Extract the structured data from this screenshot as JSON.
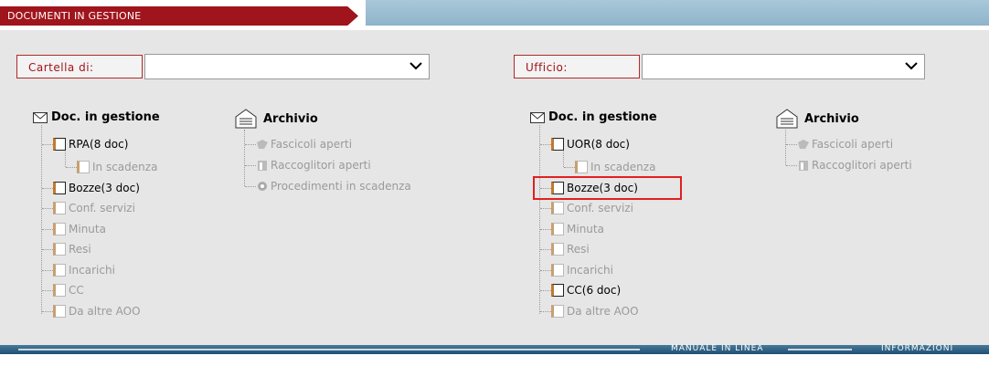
{
  "header": {
    "title": "DOCUMENTI IN GESTIONE"
  },
  "left": {
    "filter_label": "Cartella di:",
    "select_value": "",
    "doc_root": "Doc. in gestione",
    "archive_root": "Archivio",
    "doc_items": [
      {
        "label": "RPA(8 doc)",
        "active": true
      },
      {
        "label": "In scadenza",
        "active": false
      },
      {
        "label": "Bozze(3 doc)",
        "active": true
      },
      {
        "label": "Conf. servizi",
        "active": false
      },
      {
        "label": "Minuta",
        "active": false
      },
      {
        "label": "Resi",
        "active": false
      },
      {
        "label": "Incarichi",
        "active": false
      },
      {
        "label": "CC",
        "active": false
      },
      {
        "label": "Da altre AOO",
        "active": false
      }
    ],
    "archive_items": [
      {
        "label": "Fascicoli aperti",
        "icon": "folder-hand-icon"
      },
      {
        "label": "Raccoglitori aperti",
        "icon": "binder-icon"
      },
      {
        "label": "Procedimenti in scadenza",
        "icon": "gear-icon"
      }
    ]
  },
  "right": {
    "filter_label": "Ufficio:",
    "select_value": "",
    "doc_root": "Doc. in gestione",
    "archive_root": "Archivio",
    "doc_items": [
      {
        "label": "UOR(8 doc)",
        "active": true
      },
      {
        "label": "In scadenza",
        "active": false
      },
      {
        "label": "Bozze(3 doc)",
        "active": true
      },
      {
        "label": "Conf. servizi",
        "active": false
      },
      {
        "label": "Minuta",
        "active": false
      },
      {
        "label": "Resi",
        "active": false
      },
      {
        "label": "Incarichi",
        "active": false
      },
      {
        "label": "CC(6 doc)",
        "active": true
      },
      {
        "label": "Da altre AOO",
        "active": false
      }
    ],
    "archive_items": [
      {
        "label": "Fascicoli aperti",
        "icon": "folder-hand-icon"
      },
      {
        "label": "Raccoglitori aperti",
        "icon": "binder-icon"
      }
    ]
  },
  "footer": {
    "manual_link": "MANUALE IN LINEA",
    "info_link": "INFORMAZIONI"
  },
  "colors": {
    "accent": "#a0141c",
    "highlight": "#e02020",
    "bar": "#1f4f73"
  }
}
